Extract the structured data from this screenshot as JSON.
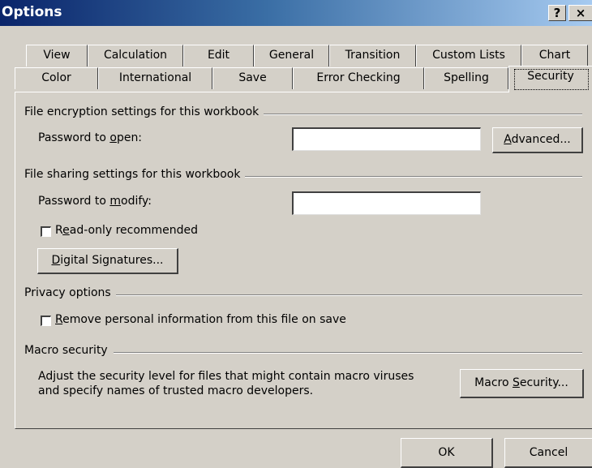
{
  "window": {
    "title": "Options",
    "help_glyph": "?",
    "close_glyph": "×"
  },
  "tabs_row1": [
    "View",
    "Calculation",
    "Edit",
    "General",
    "Transition",
    "Custom Lists",
    "Chart"
  ],
  "tabs_row2": [
    "Color",
    "International",
    "Save",
    "Error Checking",
    "Spelling",
    "Security"
  ],
  "active_tab": "Security",
  "encryption": {
    "section_title": "File encryption settings for this workbook",
    "password_open_pre": "Password to ",
    "password_open_u": "o",
    "password_open_post": "pen:",
    "password_open_value": "",
    "advanced_u": "A",
    "advanced_rest": "dvanced..."
  },
  "sharing": {
    "section_title": "File sharing settings for this workbook",
    "password_modify_pre": "Password to ",
    "password_modify_u": "m",
    "password_modify_post": "odify:",
    "password_modify_value": "",
    "readonly_pre": "R",
    "readonly_u": "e",
    "readonly_post": "ad-only recommended",
    "readonly_checked": false,
    "digsig_u": "D",
    "digsig_rest": "igital Signatures..."
  },
  "privacy": {
    "section_title": "Privacy options",
    "remove_u": "R",
    "remove_rest": "emove personal information from this file on save",
    "remove_checked": false
  },
  "macro": {
    "section_title": "Macro security",
    "desc_line1": "Adjust the security level for files that might contain macro viruses",
    "desc_line2": "and specify names of trusted macro developers.",
    "button_pre": "Macro ",
    "button_u": "S",
    "button_post": "ecurity..."
  },
  "footer": {
    "ok": "OK",
    "cancel": "Cancel"
  }
}
